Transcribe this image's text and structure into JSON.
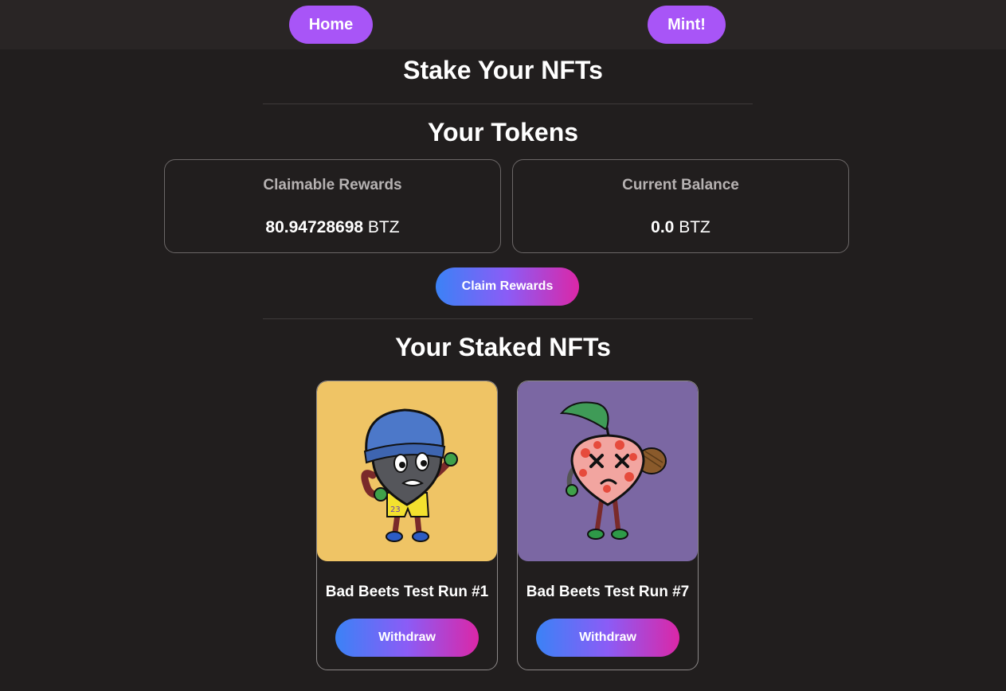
{
  "nav": {
    "home_label": "Home",
    "mint_label": "Mint!"
  },
  "page": {
    "title": "Stake Your NFTs",
    "tokens_heading": "Your Tokens",
    "staked_heading": "Your Staked NFTs"
  },
  "tokens": {
    "claimable": {
      "label": "Claimable Rewards",
      "amount": "80.94728698",
      "unit": "BTZ"
    },
    "balance": {
      "label": "Current Balance",
      "amount": "0.0",
      "unit": "BTZ"
    },
    "claim_button": "Claim Rewards"
  },
  "nfts": [
    {
      "name": "Bad Beets Test Run #1",
      "withdraw_label": "Withdraw",
      "image_background": "#efc465",
      "character": "grey beet with blue beanie and yellow jersey number 23"
    },
    {
      "name": "Bad Beets Test Run #7",
      "withdraw_label": "Withdraw",
      "image_background": "#7b67a3",
      "character": "red spotted beet with x eyes and baseball glove"
    }
  ],
  "colors": {
    "background": "#211e1e",
    "topbar": "#292525",
    "nav_button": "#a855f7",
    "gradient_start": "#3b82f6",
    "gradient_end": "#db27a7"
  }
}
